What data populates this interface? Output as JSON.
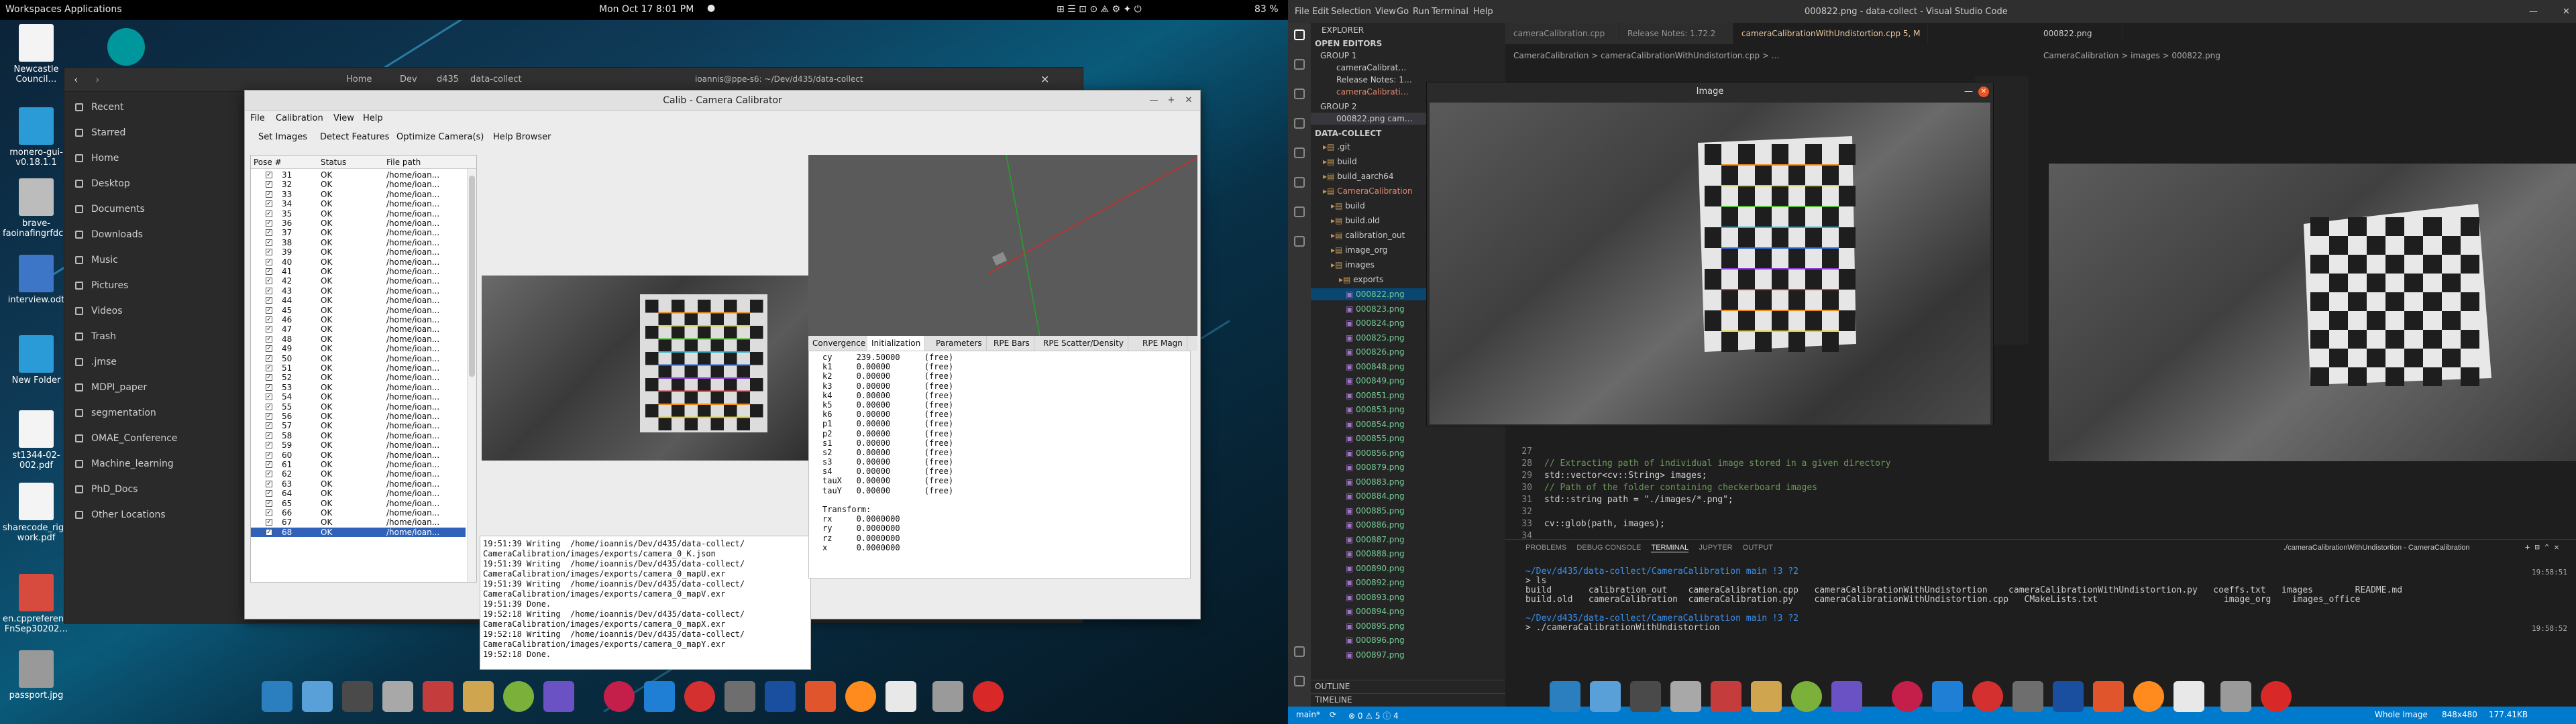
{
  "left_topbar": {
    "workspaces": "Workspaces",
    "applications": "Applications",
    "datetime": "Mon Oct 17  8:01 PM",
    "battery": "83 %"
  },
  "desktop_icons": [
    {
      "label": "Newcastle Council…"
    },
    {
      "label": "monero-gui-v0.18.1.1"
    },
    {
      "label": "brave-faoinafingrfdc…"
    },
    {
      "label": "interview.odt"
    },
    {
      "label": "New Folder"
    },
    {
      "label": "st1344-02-002.pdf"
    },
    {
      "label": "sharecode_right work.pdf"
    },
    {
      "label": "en.cppreference.com-FnSep30202…"
    },
    {
      "label": "passport.jpg"
    }
  ],
  "files_window": {
    "breadcrumb": [
      "Home",
      "Dev",
      "d435",
      "data-collect"
    ],
    "title": "ioannis@ppe-s6: ~/Dev/d435/data-collect",
    "sidebar": [
      "Recent",
      "Starred",
      "Home",
      "Desktop",
      "Documents",
      "Downloads",
      "Music",
      "Pictures",
      "Videos",
      "Trash",
      ".jmse",
      "MDPI_paper",
      "segmentation",
      "OMAE_Conference",
      "Machine_learning",
      "PhD_Docs",
      "Other Locations"
    ]
  },
  "calib_window": {
    "title": "Calib - Camera Calibrator",
    "menu": [
      "File",
      "Calibration",
      "View",
      "Help"
    ],
    "toolbar": [
      "Set Images",
      "Detect Features",
      "Optimize Camera(s)",
      "Help Browser"
    ],
    "list_headers": {
      "pose": "Pose #",
      "status": "Status",
      "path": "File path"
    },
    "poses": [
      {
        "n": "31",
        "s": "OK",
        "p": "/home/ioan..."
      },
      {
        "n": "32",
        "s": "OK",
        "p": "/home/ioan..."
      },
      {
        "n": "33",
        "s": "OK",
        "p": "/home/ioan..."
      },
      {
        "n": "34",
        "s": "OK",
        "p": "/home/ioan..."
      },
      {
        "n": "35",
        "s": "OK",
        "p": "/home/ioan..."
      },
      {
        "n": "36",
        "s": "OK",
        "p": "/home/ioan..."
      },
      {
        "n": "37",
        "s": "OK",
        "p": "/home/ioan..."
      },
      {
        "n": "38",
        "s": "OK",
        "p": "/home/ioan..."
      },
      {
        "n": "39",
        "s": "OK",
        "p": "/home/ioan..."
      },
      {
        "n": "40",
        "s": "OK",
        "p": "/home/ioan..."
      },
      {
        "n": "41",
        "s": "OK",
        "p": "/home/ioan..."
      },
      {
        "n": "42",
        "s": "OK",
        "p": "/home/ioan..."
      },
      {
        "n": "43",
        "s": "OK",
        "p": "/home/ioan..."
      },
      {
        "n": "44",
        "s": "OK",
        "p": "/home/ioan..."
      },
      {
        "n": "45",
        "s": "OK",
        "p": "/home/ioan..."
      },
      {
        "n": "46",
        "s": "OK",
        "p": "/home/ioan..."
      },
      {
        "n": "47",
        "s": "OK",
        "p": "/home/ioan..."
      },
      {
        "n": "48",
        "s": "OK",
        "p": "/home/ioan..."
      },
      {
        "n": "49",
        "s": "OK",
        "p": "/home/ioan..."
      },
      {
        "n": "50",
        "s": "OK",
        "p": "/home/ioan..."
      },
      {
        "n": "51",
        "s": "OK",
        "p": "/home/ioan..."
      },
      {
        "n": "52",
        "s": "OK",
        "p": "/home/ioan..."
      },
      {
        "n": "53",
        "s": "OK",
        "p": "/home/ioan..."
      },
      {
        "n": "54",
        "s": "OK",
        "p": "/home/ioan..."
      },
      {
        "n": "55",
        "s": "OK",
        "p": "/home/ioan..."
      },
      {
        "n": "56",
        "s": "OK",
        "p": "/home/ioan..."
      },
      {
        "n": "57",
        "s": "OK",
        "p": "/home/ioan..."
      },
      {
        "n": "58",
        "s": "OK",
        "p": "/home/ioan..."
      },
      {
        "n": "59",
        "s": "OK",
        "p": "/home/ioan..."
      },
      {
        "n": "60",
        "s": "OK",
        "p": "/home/ioan..."
      },
      {
        "n": "61",
        "s": "OK",
        "p": "/home/ioan..."
      },
      {
        "n": "62",
        "s": "OK",
        "p": "/home/ioan..."
      },
      {
        "n": "63",
        "s": "OK",
        "p": "/home/ioan..."
      },
      {
        "n": "64",
        "s": "OK",
        "p": "/home/ioan..."
      },
      {
        "n": "65",
        "s": "OK",
        "p": "/home/ioan..."
      },
      {
        "n": "66",
        "s": "OK",
        "p": "/home/ioan..."
      },
      {
        "n": "67",
        "s": "OK",
        "p": "/home/ioan..."
      },
      {
        "n": "68",
        "s": "OK",
        "p": "/home/ioan..."
      }
    ],
    "log": [
      "19:51:39 Writing  /home/ioannis/Dev/d435/data-collect/",
      "CameraCalibration/images/exports/camera_0_K.json",
      "19:51:39 Writing  /home/ioannis/Dev/d435/data-collect/",
      "CameraCalibration/images/exports/camera_0_mapU.exr",
      "19:51:39 Writing  /home/ioannis/Dev/d435/data-collect/",
      "CameraCalibration/images/exports/camera_0_mapV.exr",
      "19:51:39 Done.",
      "19:52:18 Writing  /home/ioannis/Dev/d435/data-collect/",
      "CameraCalibration/images/exports/camera_0_mapX.exr",
      "19:52:18 Writing  /home/ioannis/Dev/d435/data-collect/",
      "CameraCalibration/images/exports/camera_0_mapY.exr",
      "19:52:18 Done."
    ],
    "tabs": [
      "Convergence",
      "Initialization",
      "Parameters",
      "RPE Bars",
      "RPE Scatter/Density",
      "RPE Magn"
    ],
    "params": [
      "cy     239.50000     (free)",
      "k1     0.00000       (free)",
      "k2     0.00000       (free)",
      "k3     0.00000       (free)",
      "k4     0.00000       (free)",
      "k5     0.00000       (free)",
      "k6     0.00000       (free)",
      "p1     0.00000       (free)",
      "p2     0.00000       (free)",
      "s1     0.00000       (free)",
      "s2     0.00000       (free)",
      "s3     0.00000       (free)",
      "s4     0.00000       (free)",
      "tauX   0.00000       (free)",
      "tauY   0.00000       (free)",
      "",
      "Transform:",
      "rx     0.0000000",
      "ry     0.0000000",
      "rz     0.0000000",
      "x      0.0000000"
    ]
  },
  "vscode": {
    "menu": [
      "File",
      "Edit",
      "Selection",
      "View",
      "Go",
      "Run",
      "Terminal",
      "Help"
    ],
    "title": "000822.png - data-collect - Visual Studio Code",
    "explorer_title": "EXPLORER",
    "open_editors": "OPEN EDITORS",
    "group1": "GROUP 1",
    "group2": "GROUP 2",
    "open_files": [
      "cameraCalibrat…",
      "Release Notes: 1…",
      "cameraCalibrati…"
    ],
    "group2_file": "000822.png  cam…",
    "root": "DATA-COLLECT",
    "tree": [
      ".git",
      "build",
      "build_aarch64",
      "CameraCalibration",
      "build",
      "build.old",
      "calibration_out",
      "image_org",
      "images",
      "exports"
    ],
    "images": [
      "000822.png",
      "000823.png",
      "000824.png",
      "000825.png",
      "000826.png",
      "000848.png",
      "000849.png",
      "000851.png",
      "000853.png",
      "000854.png",
      "000855.png",
      "000856.png",
      "000879.png",
      "000883.png",
      "000884.png",
      "000885.png",
      "000886.png",
      "000887.png",
      "000888.png",
      "000890.png",
      "000892.png",
      "000893.png",
      "000894.png",
      "000895.png",
      "000896.png",
      "000897.png"
    ],
    "outline": "OUTLINE",
    "timeline": "TIMELINE",
    "editor_tabs": [
      "cameraCalibration.cpp",
      "Release Notes: 1.72.2",
      "cameraCalibrationWithUndistortion.cpp 5, M"
    ],
    "editor_breadcrumb": "CameraCalibration > cameraCalibrationWithUndistortion.cpp > …",
    "code": [
      {
        "n": "27",
        "t": ""
      },
      {
        "n": "28",
        "t": "// Extracting path of individual image stored in a given directory"
      },
      {
        "n": "29",
        "t": "std::vector<cv::String> images;"
      },
      {
        "n": "30",
        "t": "// Path of the folder containing checkerboard images"
      },
      {
        "n": "31",
        "t": "std::string path = \"./images/*.png\";"
      },
      {
        "n": "32",
        "t": ""
      },
      {
        "n": "33",
        "t": "cv::glob(path, images);"
      },
      {
        "n": "34",
        "t": ""
      }
    ],
    "image_tab": "000822.png",
    "image_breadcrumb": "CameraCalibration > images > 000822.png",
    "popup_title": "Image",
    "panel_tabs": [
      "PROBLEMS",
      "DEBUG CONSOLE",
      "TERMINAL",
      "JUPYTER",
      "OUTPUT"
    ],
    "terminal_task": "./cameraCalibrationWithUndistortion - CameraCalibration",
    "term": [
      "~/Dev/d435/data-collect/CameraCalibration main !3 ?2",
      "> ls",
      "build       calibration_out    cameraCalibration.cpp   cameraCalibrationWithUndistortion    cameraCalibrationWithUndistortion.py   coeffs.txt   images        README.md",
      "build.old   cameraCalibration  cameraCalibration.py    cameraCalibrationWithUndistortion.cpp   CMakeLists.txt                        image_org    images_office",
      "",
      "~/Dev/d435/data-collect/CameraCalibration main !3 ?2",
      "> ./cameraCalibrationWithUndistortion"
    ],
    "term_times": [
      "19:58:51",
      "19:58:52"
    ],
    "status": {
      "branch": "main*",
      "sync": "⟳",
      "errors": "⊗ 0 ⚠ 5 ⓘ 4",
      "image_size": "Whole Image",
      "dims": "848x480",
      "filesize": "177.41KB"
    }
  }
}
